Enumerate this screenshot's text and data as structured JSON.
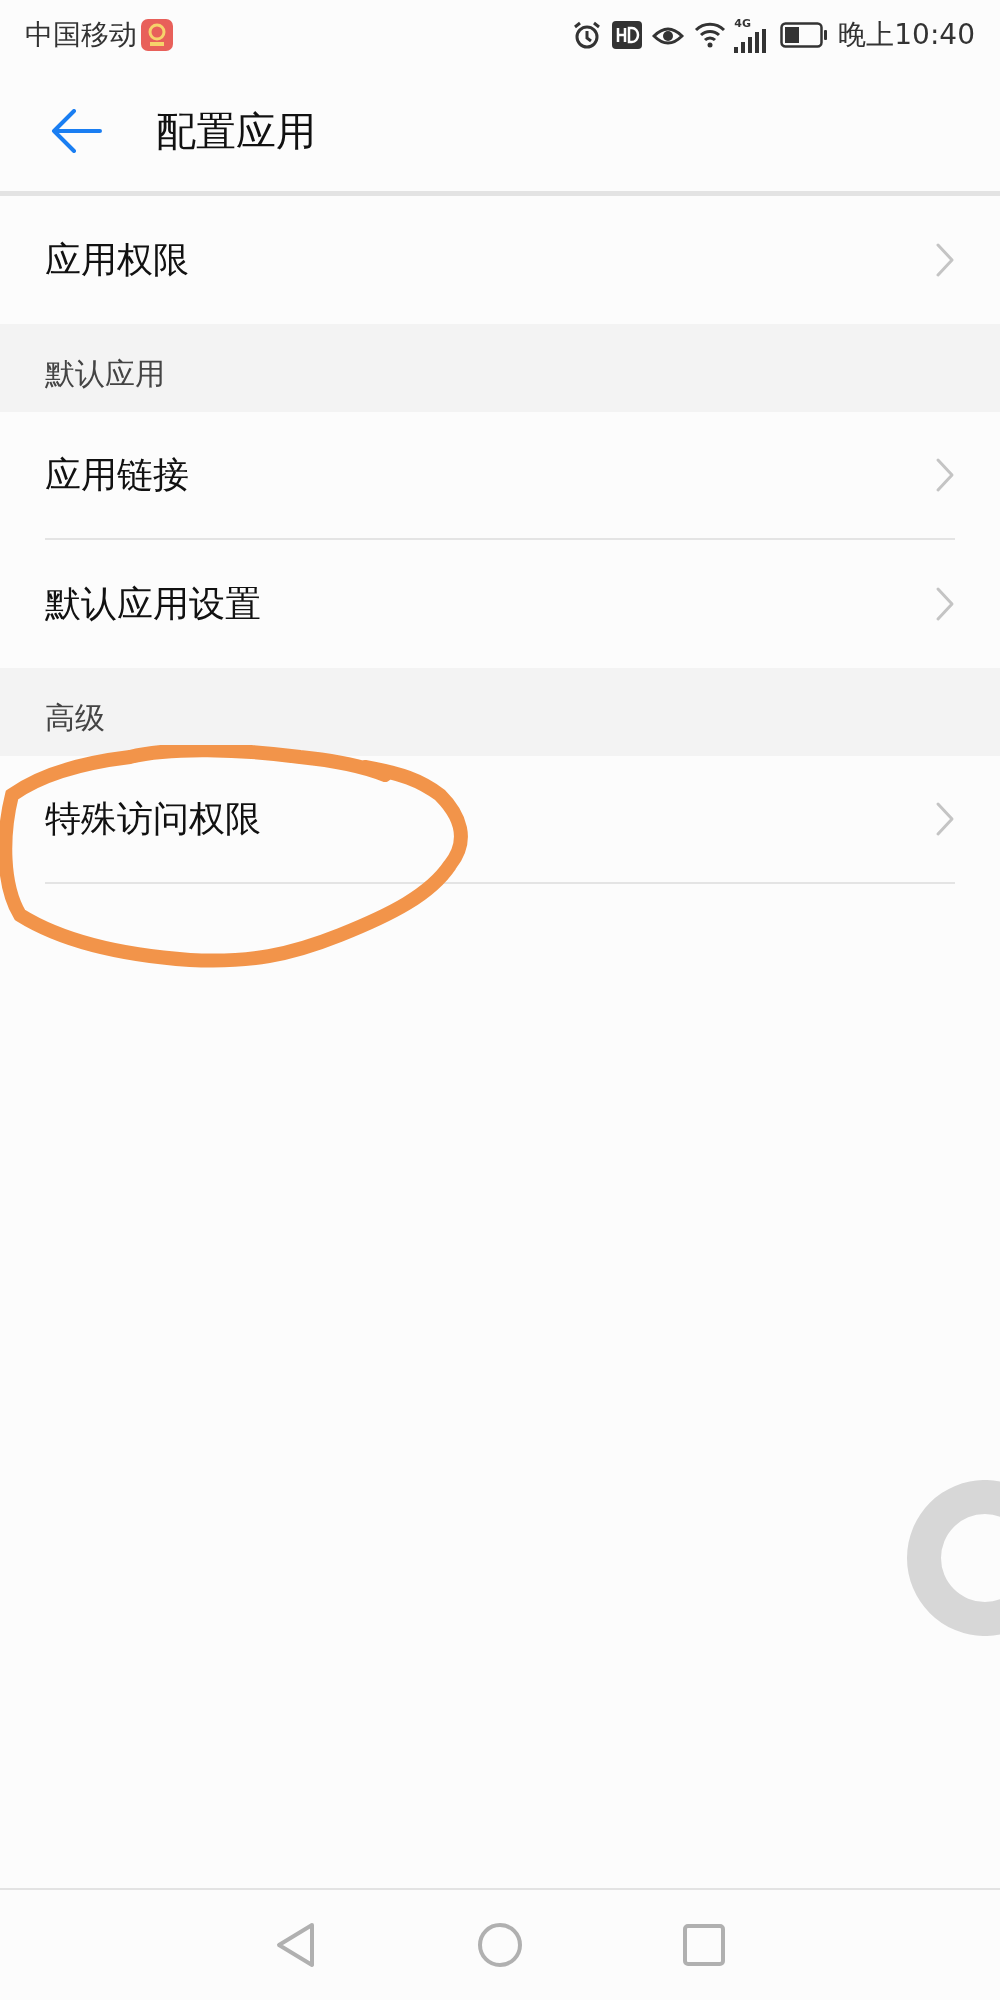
{
  "status_bar": {
    "carrier": "中国移动",
    "network": "4G",
    "time": "晚上10:40"
  },
  "header": {
    "title": "配置应用"
  },
  "sections": [
    {
      "items": [
        {
          "label": "应用权限"
        }
      ]
    },
    {
      "title": "默认应用",
      "items": [
        {
          "label": "应用链接"
        },
        {
          "label": "默认应用设置"
        }
      ]
    },
    {
      "title": "高级",
      "items": [
        {
          "label": "特殊访问权限"
        }
      ]
    }
  ]
}
